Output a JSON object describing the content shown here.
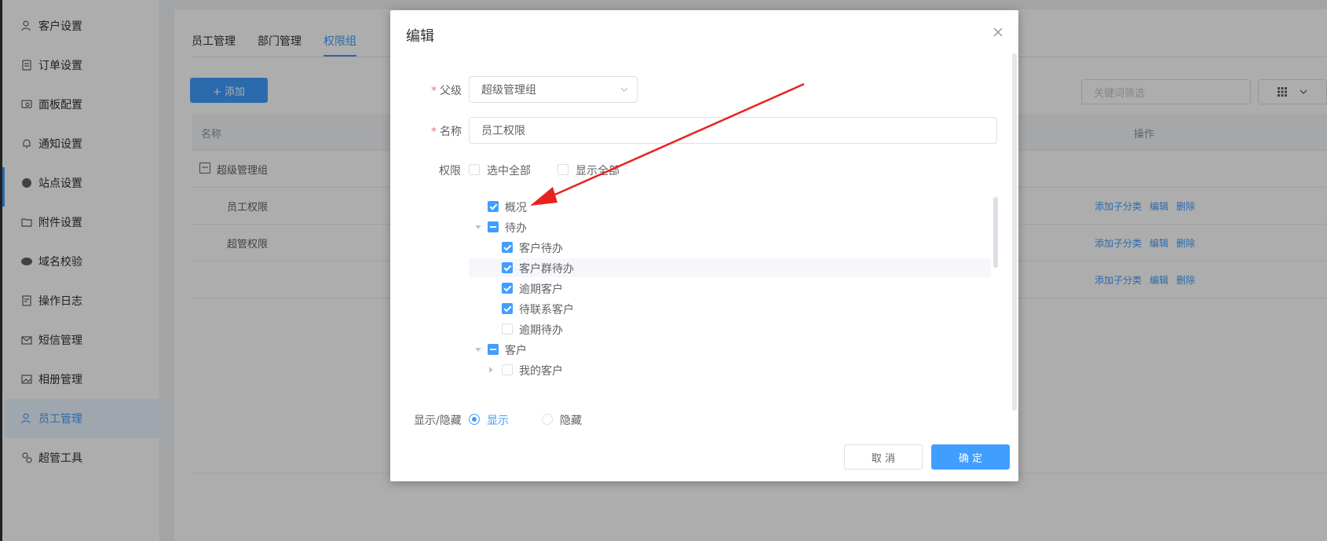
{
  "sidebar": {
    "items": [
      {
        "label": "客户设置",
        "icon": "user-gear-icon"
      },
      {
        "label": "订单设置",
        "icon": "order-icon"
      },
      {
        "label": "面板配置",
        "icon": "panel-icon"
      },
      {
        "label": "通知设置",
        "icon": "bell-icon"
      },
      {
        "label": "站点设置",
        "icon": "globe-icon"
      },
      {
        "label": "附件设置",
        "icon": "folder-icon"
      },
      {
        "label": "域名校验",
        "icon": "www-icon"
      },
      {
        "label": "操作日志",
        "icon": "log-icon"
      },
      {
        "label": "短信管理",
        "icon": "mail-icon"
      },
      {
        "label": "相册管理",
        "icon": "album-icon"
      },
      {
        "label": "员工管理",
        "icon": "staff-icon"
      },
      {
        "label": "超管工具",
        "icon": "tools-icon"
      }
    ],
    "active_label": "员工管理"
  },
  "main": {
    "tabs": [
      {
        "label": "员工管理"
      },
      {
        "label": "部门管理"
      },
      {
        "label": "权限组"
      }
    ],
    "active_tab": "权限组",
    "add_button": "+ 添加",
    "keyword_placeholder": "关键词筛选",
    "table": {
      "headers": {
        "name": "名称",
        "ops": "操作"
      },
      "rows": [
        {
          "name": "超级管理组",
          "expander": "−"
        },
        {
          "name": "员工权限",
          "ops": [
            "添加子分类",
            "编辑",
            "删除"
          ]
        },
        {
          "name": "超管权限",
          "ops": [
            "添加子分类",
            "编辑",
            "删除"
          ]
        },
        {
          "name": "",
          "ops": [
            "添加子分类",
            "编辑",
            "删除"
          ]
        }
      ]
    }
  },
  "dialog": {
    "title": "编辑",
    "parent_label": "父级",
    "parent_value": "超级管理组",
    "name_label": "名称",
    "name_value": "员工权限",
    "perm_label": "权限",
    "select_all": "选中全部",
    "show_all": "显示全部",
    "tree": [
      {
        "label": "概况",
        "level": 1,
        "state": "checked",
        "caret": "none"
      },
      {
        "label": "待办",
        "level": 1,
        "state": "indeterminate",
        "caret": "down"
      },
      {
        "label": "客户待办",
        "level": 2,
        "state": "checked",
        "caret": "none"
      },
      {
        "label": "客户群待办",
        "level": 2,
        "state": "checked",
        "caret": "none",
        "highlight": true
      },
      {
        "label": "逾期客户",
        "level": 2,
        "state": "checked",
        "caret": "none"
      },
      {
        "label": "待联系客户",
        "level": 2,
        "state": "checked",
        "caret": "none"
      },
      {
        "label": "逾期待办",
        "level": 2,
        "state": "unchecked",
        "caret": "none"
      },
      {
        "label": "客户",
        "level": 1,
        "state": "indeterminate",
        "caret": "down"
      },
      {
        "label": "我的客户",
        "level": 2,
        "state": "unchecked",
        "caret": "right"
      }
    ],
    "visibility_label": "显示/隐藏",
    "visibility_options": [
      {
        "label": "显示",
        "selected": true
      },
      {
        "label": "隐藏",
        "selected": false
      }
    ],
    "cancel": "取 消",
    "ok": "确 定"
  },
  "colors": {
    "primary": "#409eff",
    "annotation_arrow": "#e8231f",
    "required": "#f56c6c"
  }
}
